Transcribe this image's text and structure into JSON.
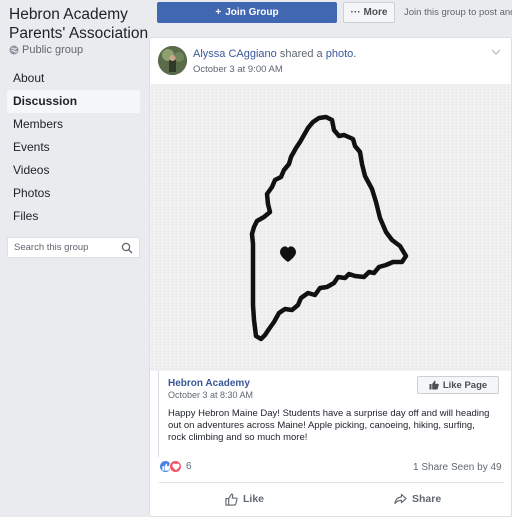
{
  "sidebar": {
    "group_name": "Hebron Academy Parents' Association",
    "group_type": "Public group",
    "nav": [
      {
        "label": "About"
      },
      {
        "label": "Discussion"
      },
      {
        "label": "Members"
      },
      {
        "label": "Events"
      },
      {
        "label": "Videos"
      },
      {
        "label": "Photos"
      },
      {
        "label": "Files"
      }
    ],
    "search_placeholder": "Search this group"
  },
  "topbar": {
    "join_label": "Join Group",
    "join_icon": "+",
    "more_label": "More",
    "more_icon": "···",
    "join_text": "Join this group to post and"
  },
  "post": {
    "poster": "Alyssa CAggiano",
    "action": "shared a",
    "object": "photo.",
    "time": "October 3 at 9:00 AM",
    "shared": {
      "page_name": "Hebron Academy",
      "time": "October 3 at 8:30 AM",
      "like_page_label": "Like Page",
      "text": "Happy Hebron Maine Day! Students have a surprise day off and will heading out on adventures across Maine! Apple picking, canoeing, hiking, surfing, rock climbing and so much more!"
    },
    "reaction_count": "6",
    "shares": "1 Share",
    "seen": "Seen by 49",
    "like_label": "Like",
    "share_label": "Share"
  },
  "colors": {
    "brand": "#4267b2",
    "link": "#385898",
    "background": "#e9ebee"
  }
}
